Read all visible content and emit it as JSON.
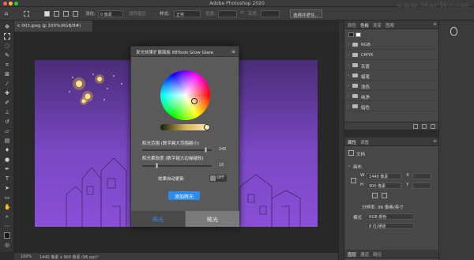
{
  "app": {
    "title": "Adobe Photoshop 2020",
    "watermark": "www.MacW.com"
  },
  "options": {
    "feather_label": "羽化:",
    "feather_value": "0 像素",
    "antialias_label": "消除锯齿",
    "style_label": "样式:",
    "style_value": "正常",
    "width_label": "宽度:",
    "height_label": "高度:",
    "select_mask_label": "选择并遮住..."
  },
  "document": {
    "tab_label": "003.jpeg @ 100%(RGB/8#)",
    "zoom": "100%",
    "doc_info": "1440 像素 x 900 像素 (96 ppi)"
  },
  "plugin": {
    "title": "发光效果扩展面板 88Tools Glow Glare",
    "menu_icon": "≡",
    "range_label": "辉光范围 (数字越大范围越小)",
    "range_value": "245",
    "softness_label": "辉光柔软度 (数字越大边缘越软)",
    "softness_value": "10",
    "auto_update_label": "效果自动更新",
    "auto_update_state": "OFF",
    "apply_button": "添加辉光",
    "tab_glow": "辉光",
    "tab_glare": "眩光",
    "accent_color": "#2d8ceb",
    "range_fraction": 0.92,
    "softness_fraction": 0.22
  },
  "channels_panel": {
    "tabs": [
      "颜色",
      "色板",
      "渐变",
      "图案"
    ],
    "active_tab": "色板",
    "items": [
      "RGB",
      "CMYK",
      "灰度",
      "蜡笔",
      "浅色",
      "纯净",
      "暗色"
    ]
  },
  "properties_panel": {
    "tabs": [
      "属性",
      "调整"
    ],
    "active_tab": "属性",
    "doc_section": "文档",
    "canvas_section": "画布",
    "width_label": "W",
    "width_value": "1440 像素",
    "height_label": "H",
    "height_value": "900 像素",
    "x_label": "X",
    "y_label": "Y",
    "resolution": "分辨率: 96 像素/英寸",
    "mode_label": "模式",
    "mode_value": "RGB 颜色",
    "depth_value": "8 位/通道"
  },
  "layers_panel": {
    "tabs": [
      "图层",
      "通道",
      "路径"
    ],
    "active_tab": "图层"
  }
}
